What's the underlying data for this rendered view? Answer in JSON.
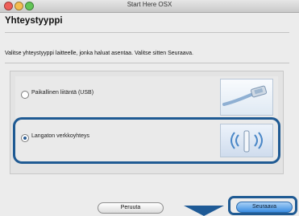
{
  "window": {
    "title": "Start Here OSX"
  },
  "page": {
    "heading": "Yhteystyyppi",
    "instructions": "Valitse yhteystyyppi laitteelle, jonka haluat asentaa. Valitse sitten Seuraava."
  },
  "options": [
    {
      "label": "Paikallinen liitäntä (USB)",
      "selected": false,
      "icon": "usb-cable-icon"
    },
    {
      "label": "Langaton verkkoyhteys",
      "selected": true,
      "icon": "wireless-icon"
    }
  ],
  "buttons": {
    "cancel": "Peruuta",
    "next": "Seuraava"
  },
  "colors": {
    "highlight": "#1f5a93",
    "primary_button": "#3b8ee2"
  }
}
